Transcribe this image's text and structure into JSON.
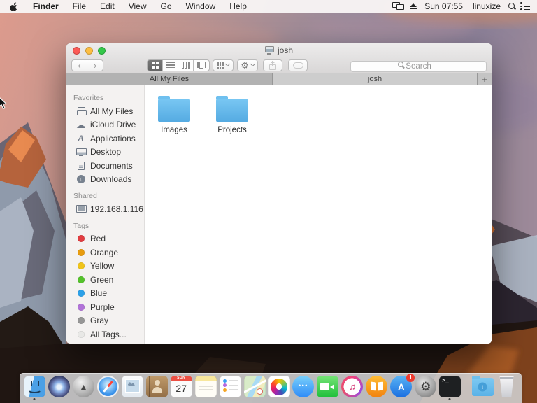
{
  "menu_bar": {
    "app_menu": "Finder",
    "menus": [
      "File",
      "Edit",
      "View",
      "Go",
      "Window",
      "Help"
    ],
    "status": {
      "time": "Sun 07:55",
      "user": "linuxize"
    }
  },
  "window": {
    "title": "josh",
    "tabs": [
      {
        "label": "All My Files",
        "active": false
      },
      {
        "label": "josh",
        "active": true
      }
    ],
    "new_tab_label": "+",
    "toolbar": {
      "search_placeholder": "Search",
      "back": "‹",
      "forward": "›"
    },
    "sidebar": {
      "favorites_header": "Favorites",
      "favorites": [
        "All My Files",
        "iCloud Drive",
        "Applications",
        "Desktop",
        "Documents",
        "Downloads"
      ],
      "shared_header": "Shared",
      "shared_item": "192.168.1.116",
      "tags_header": "Tags",
      "tags": [
        {
          "label": "Red",
          "color": "#e13c40"
        },
        {
          "label": "Orange",
          "color": "#e89c0e"
        },
        {
          "label": "Yellow",
          "color": "#f0c419"
        },
        {
          "label": "Green",
          "color": "#54c22b"
        },
        {
          "label": "Blue",
          "color": "#2ba0e8"
        },
        {
          "label": "Purple",
          "color": "#b173d8"
        },
        {
          "label": "Gray",
          "color": "#969696"
        },
        {
          "label": "All Tags...",
          "color": "#e8e8e6"
        }
      ]
    },
    "folders": [
      {
        "name": "Images"
      },
      {
        "name": "Projects"
      }
    ]
  },
  "dock": {
    "apps": [
      "Finder",
      "Siri",
      "Launchpad",
      "Safari",
      "Mail",
      "Contacts",
      "Calendar",
      "Notes",
      "Reminders",
      "Maps",
      "Photos",
      "Messages",
      "FaceTime",
      "iTunes",
      "iBooks",
      "App Store",
      "System Preferences",
      "Terminal",
      "Downloads",
      "Trash"
    ],
    "running_apps": [
      "Finder",
      "Terminal"
    ],
    "calendar": {
      "weekday": "SUN",
      "day": "27"
    },
    "app_store_badge": "1"
  },
  "icon_glyphs": {
    "cloud": "☁",
    "applications_a": "A",
    "downloads_arrow": "↓",
    "gear": "⚙",
    "rocket": "▲",
    "messages_dots": "•••",
    "music_note": "♫",
    "app_store_letter": "A",
    "terminal_glyph": ">_",
    "download_circle_arrow": "↓"
  },
  "colors": {
    "folder_blue": "#5fb3e9",
    "traffic_red": "#fc5b57",
    "traffic_yellow": "#fdbe41",
    "traffic_green": "#34c84a",
    "selection_dark": "#6d6d6d"
  }
}
